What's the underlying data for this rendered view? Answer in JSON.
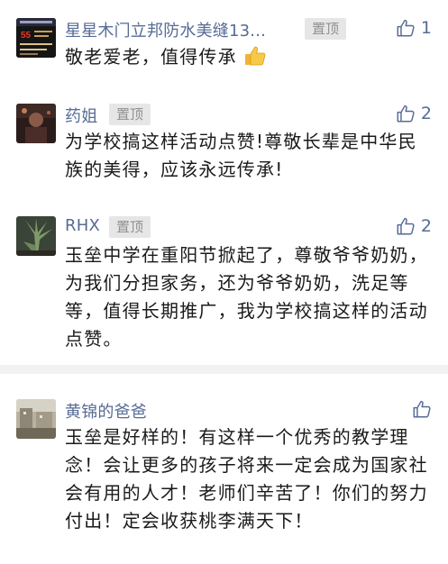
{
  "comments": [
    {
      "name": "星星木门立邦防水美缝13...",
      "pin_label": "置顶",
      "likes": "1",
      "text": "敬老爱老，值得传承"
    },
    {
      "name": "药姐",
      "pin_label": "置顶",
      "likes": "2",
      "text": "为学校搞这样活动点赞!尊敬长辈是中华民族的美得，应该永远传承!"
    },
    {
      "name": "RHX",
      "pin_label": "置顶",
      "likes": "2",
      "text": "玉垒中学在重阳节掀起了，尊敬爷爷奶奶，为我们分担家务，还为爷爷奶奶，洗足等等，值得长期推广，我为学校搞这样的活动点赞。"
    },
    {
      "name": "黄锦的爸爸",
      "likes": "",
      "text": "玉垒是好样的！有这样一个优秀的教学理念！会让更多的孩子将来一定会成为国家社会有用的人才！老师们辛苦了！你们的努力付出！定会收获桃李满天下！"
    }
  ],
  "avatars": {
    "c1_logo_text": "55"
  },
  "colors": {
    "name": "#576b95",
    "text": "#1a1a1a",
    "pin_bg": "#e6e6e6",
    "pin_text": "#909090",
    "divider": "#f2f2f2"
  }
}
